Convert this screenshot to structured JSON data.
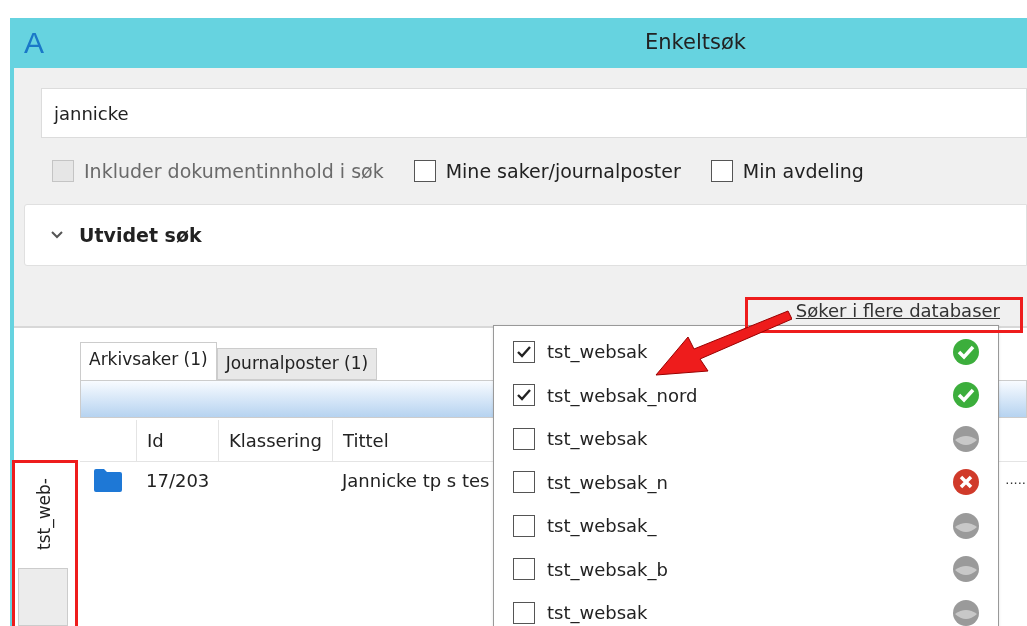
{
  "window": {
    "title": "Enkeltsøk",
    "logo": "A"
  },
  "search": {
    "value": "jannicke"
  },
  "options": [
    {
      "label": "Inkluder dokumentinnhold i søk",
      "checked": false,
      "disabled": true
    },
    {
      "label": "Mine saker/journalposter",
      "checked": false,
      "disabled": false
    },
    {
      "label": "Min avdeling",
      "checked": false,
      "disabled": false
    }
  ],
  "expander": {
    "label": "Utvidet søk",
    "expanded": false
  },
  "databases_link": "Søker i flere databaser",
  "side_tab": {
    "label": "tst_web-"
  },
  "tabs": [
    {
      "label": "Arkivsaker (1)",
      "selected": true
    },
    {
      "label": "Journalposter (1)",
      "selected": false
    }
  ],
  "table": {
    "columns": [
      "Id",
      "Klassering",
      "Tittel"
    ],
    "rows": [
      {
        "kind": "folder",
        "id": "17/203",
        "tittel": "Jannicke tp s tes",
        "column_4": "....."
      }
    ]
  },
  "databases": [
    {
      "name": "tst_websak",
      "checked": true,
      "kind": "ok"
    },
    {
      "name": "tst_websak_nord",
      "checked": true,
      "kind": "ok"
    },
    {
      "name": "tst_websak",
      "checked": false,
      "kind": "unknown"
    },
    {
      "name": "tst_websak_n",
      "checked": false,
      "kind": "error"
    },
    {
      "name": "tst_websak_",
      "checked": false,
      "kind": "unknown"
    },
    {
      "name": "tst_websak_b",
      "checked": false,
      "kind": "unknown"
    },
    {
      "name": "tst_websak",
      "checked": false,
      "kind": "unknown"
    }
  ]
}
